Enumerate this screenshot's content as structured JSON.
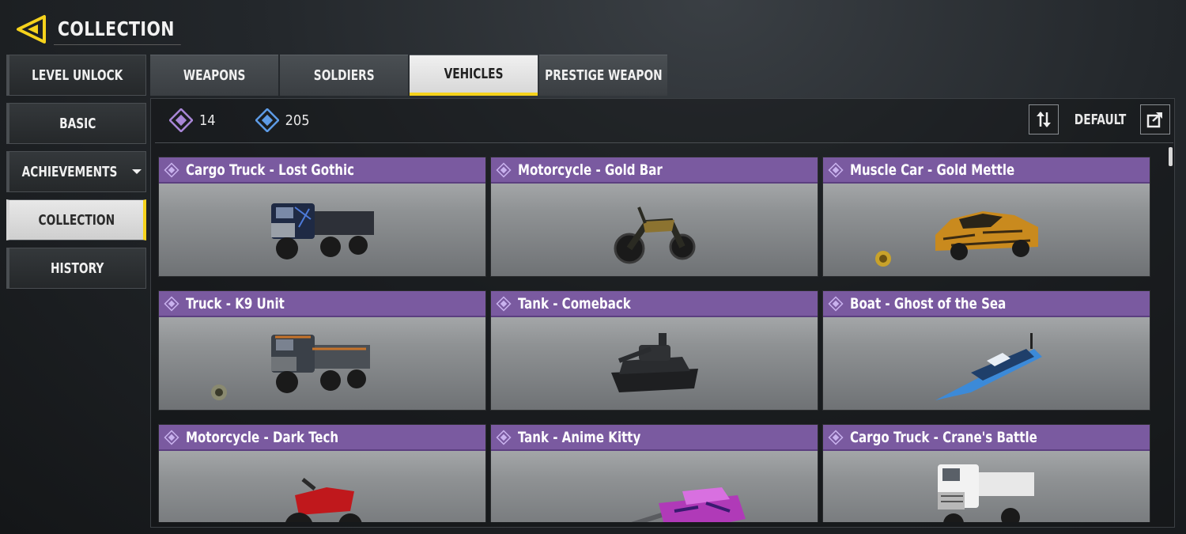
{
  "header": {
    "title": "COLLECTION"
  },
  "sidebar": {
    "items": [
      {
        "label": "LEVEL UNLOCK"
      },
      {
        "label": "BASIC"
      },
      {
        "label": "ACHIEVEMENTS"
      },
      {
        "label": "COLLECTION"
      },
      {
        "label": "HISTORY"
      }
    ]
  },
  "tabs": [
    {
      "label": "WEAPONS"
    },
    {
      "label": "SOLDIERS"
    },
    {
      "label": "VEHICLES"
    },
    {
      "label": "PRESTIGE WEAPON"
    }
  ],
  "counters": {
    "purple_count": "14",
    "blue_count": "205"
  },
  "sort": {
    "label": "DEFAULT"
  },
  "colors": {
    "accent_yellow": "#f5d21c",
    "rarity_purple": "#7a5aa0",
    "rarity_blue": "#4f8fe0"
  },
  "vehicles": [
    {
      "name": "Cargo Truck - Lost Gothic",
      "icon": "cargo-truck-icon"
    },
    {
      "name": "Motorcycle - Gold Bar",
      "icon": "motorcycle-icon"
    },
    {
      "name": "Muscle Car - Gold Mettle",
      "icon": "muscle-car-icon"
    },
    {
      "name": "Truck - K9 Unit",
      "icon": "truck-icon"
    },
    {
      "name": "Tank - Comeback",
      "icon": "tank-icon"
    },
    {
      "name": "Boat - Ghost of the Sea",
      "icon": "boat-icon"
    },
    {
      "name": "Motorcycle - Dark Tech",
      "icon": "motorcycle-icon"
    },
    {
      "name": "Tank - Anime Kitty",
      "icon": "tank-icon"
    },
    {
      "name": "Cargo Truck - Crane's Battle",
      "icon": "cargo-truck-icon"
    }
  ]
}
